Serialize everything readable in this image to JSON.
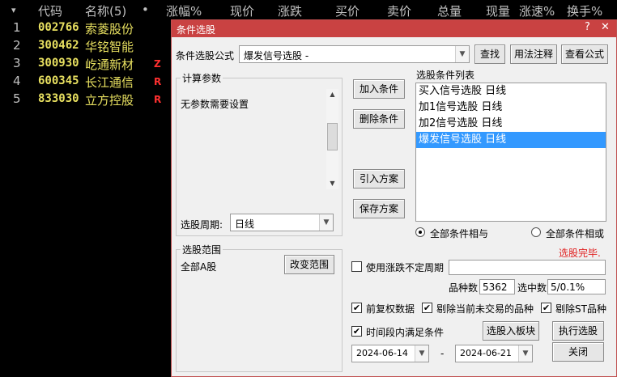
{
  "grid": {
    "columns": [
      {
        "id": "menu",
        "label": "▾"
      },
      {
        "id": "code",
        "label": "代码"
      },
      {
        "id": "name",
        "label": "名称(5)"
      },
      {
        "id": "dot",
        "label": "•"
      },
      {
        "id": "chg_pct",
        "label": "涨幅%"
      },
      {
        "id": "price",
        "label": "现价"
      },
      {
        "id": "chg",
        "label": "涨跌"
      },
      {
        "id": "bid",
        "label": "买价"
      },
      {
        "id": "ask",
        "label": "卖价"
      },
      {
        "id": "vol",
        "label": "总量"
      },
      {
        "id": "cur_vol",
        "label": "现量"
      },
      {
        "id": "speed",
        "label": "涨速%"
      },
      {
        "id": "turnover",
        "label": "换手%"
      }
    ],
    "rows": [
      {
        "idx": "1",
        "code": "002766",
        "name": "索菱股份",
        "flag": ""
      },
      {
        "idx": "2",
        "code": "300462",
        "name": "华铭智能",
        "flag": ""
      },
      {
        "idx": "3",
        "code": "300930",
        "name": "屹通新材",
        "flag": "Z"
      },
      {
        "idx": "4",
        "code": "600345",
        "name": "长江通信",
        "flag": "R"
      },
      {
        "idx": "5",
        "code": "833030",
        "name": "立方控股",
        "flag": "R"
      }
    ]
  },
  "dialog": {
    "title": "条件选股",
    "title_buttons": {
      "help": "?",
      "close": "✕"
    },
    "formula_label": "条件选股公式",
    "formula_value": "爆发信号选股 -",
    "find_button": "查找",
    "usage_button": "用法注释",
    "view_formula_button": "查看公式",
    "params_group_title": "计算参数",
    "params_text": "无参数需要设置",
    "period_label": "选股周期:",
    "period_value": "日线",
    "add_condition_button": "加入条件",
    "delete_condition_button": "删除条件",
    "import_scheme_button": "引入方案",
    "save_scheme_button": "保存方案",
    "conditions_list_label": "选股条件列表",
    "conditions": [
      {
        "label": "买入信号选股  日线",
        "selected": false
      },
      {
        "label": "加1信号选股  日线",
        "selected": false
      },
      {
        "label": "加2信号选股  日线",
        "selected": false
      },
      {
        "label": "爆发信号选股  日线",
        "selected": true
      }
    ],
    "radio_and_label": "全部条件相与",
    "radio_or_label": "全部条件相或",
    "status_text": "选股完毕.",
    "range_group_title": "选股范围",
    "range_value": "全部A股",
    "change_range_button": "改变范围",
    "use_uncertain_period_label": "使用涨跌不定周期",
    "count_label": "品种数",
    "count_value": "5362",
    "selected_label": "选中数",
    "selected_value": "5/0.1%",
    "fq_data_label": "前复权数据",
    "exclude_untraded_label": "剔除当前未交易的品种",
    "exclude_st_label": "剔除ST品种",
    "period_satisfy_label": "时间段内满足条件",
    "to_block_button": "选股入板块",
    "execute_button": "执行选股",
    "date_from": "2024-06-14",
    "date_sep": "-",
    "date_to": "2024-06-21",
    "close_button": "关闭"
  }
}
